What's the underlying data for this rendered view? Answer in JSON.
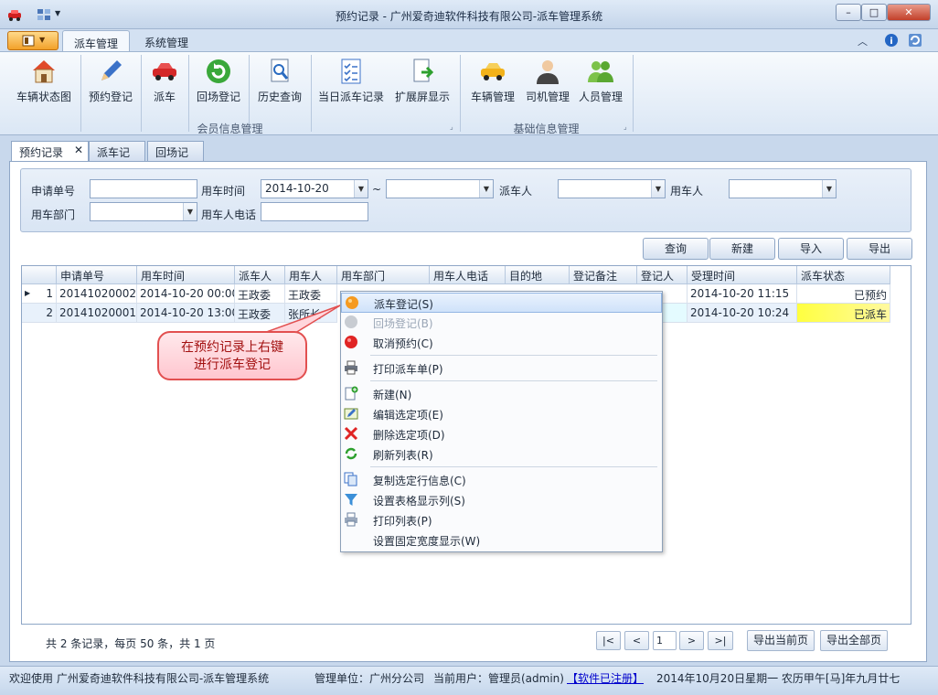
{
  "window": {
    "title": "预约记录 - 广州爱奇迪软件科技有限公司-派车管理系统"
  },
  "ribbon": {
    "tabs": [
      {
        "label": "派车管理"
      },
      {
        "label": "系统管理"
      }
    ],
    "groups": [
      {
        "label": "会员信息管理"
      },
      {
        "label": "基础信息管理"
      }
    ],
    "buttons": [
      {
        "label": "车辆状态图"
      },
      {
        "label": "预约登记"
      },
      {
        "label": "派车"
      },
      {
        "label": "回场登记"
      },
      {
        "label": "历史查询"
      },
      {
        "label": "当日派车记录"
      },
      {
        "label": "扩展屏显示"
      },
      {
        "label": "车辆管理"
      },
      {
        "label": "司机管理"
      },
      {
        "label": "人员管理"
      }
    ]
  },
  "doc_tabs": [
    {
      "label": "预约记录"
    },
    {
      "label": "派车记录"
    },
    {
      "label": "回场记录"
    }
  ],
  "filter": {
    "request_no_label": "申请单号",
    "use_time_label": "用车时间",
    "date_from": "2014-10-20",
    "range_sep": "~",
    "dispatcher_label": "派车人",
    "user_label": "用车人",
    "department_label": "用车部门",
    "phone_label": "用车人电话"
  },
  "actions": {
    "query": "查询",
    "create": "新建",
    "import": "导入",
    "export": "导出"
  },
  "grid": {
    "columns": [
      "申请单号",
      "用车时间",
      "派车人",
      "用车人",
      "用车部门",
      "用车人电话",
      "目的地",
      "登记备注",
      "登记人",
      "受理时间",
      "派车状态"
    ],
    "rows": [
      {
        "no": "1",
        "request_no": "20141020002",
        "use_time": "2014-10-20 00:00",
        "dispatcher": "王政委",
        "user": "王政委",
        "accept_time": "2014-10-20 11:15",
        "status": "已预约"
      },
      {
        "no": "2",
        "request_no": "20141020001",
        "use_time": "2014-10-20 13:00",
        "dispatcher": "王政委",
        "user": "张所长",
        "accept_time": "2014-10-20 10:24",
        "status": "已派车"
      }
    ]
  },
  "context_menu": {
    "items": [
      {
        "label": "派车登记(S)"
      },
      {
        "label": "回场登记(B)"
      },
      {
        "label": "取消预约(C)"
      },
      {
        "label": "打印派车单(P)"
      },
      {
        "label": "新建(N)"
      },
      {
        "label": "编辑选定项(E)"
      },
      {
        "label": "删除选定项(D)"
      },
      {
        "label": "刷新列表(R)"
      },
      {
        "label": "复制选定行信息(C)"
      },
      {
        "label": "设置表格显示列(S)"
      },
      {
        "label": "打印列表(P)"
      },
      {
        "label": "设置固定宽度显示(W)"
      }
    ]
  },
  "callout": {
    "line1": "在预约记录上右键",
    "line2": "进行派车登记"
  },
  "pager": {
    "summary": "共 2 条记录，每页 50 条，共 1 页",
    "first": "|<",
    "prev": "<",
    "page": "1",
    "next": ">",
    "last": ">|",
    "export_current": "导出当前页",
    "export_all": "导出全部页"
  },
  "status": {
    "welcome": "欢迎使用 广州爱奇迪软件科技有限公司-派车管理系统",
    "unit": "管理单位：广州分公司",
    "current_user": "当前用户：管理员(admin)",
    "registered": "【软件已注册】",
    "datetime": "2014年10月20日星期一 农历甲午[马]年九月廿七"
  },
  "colors": {
    "accent": "#f2a12a",
    "highlight_yellow": "#ffff40",
    "status_link": "#0000cc"
  }
}
